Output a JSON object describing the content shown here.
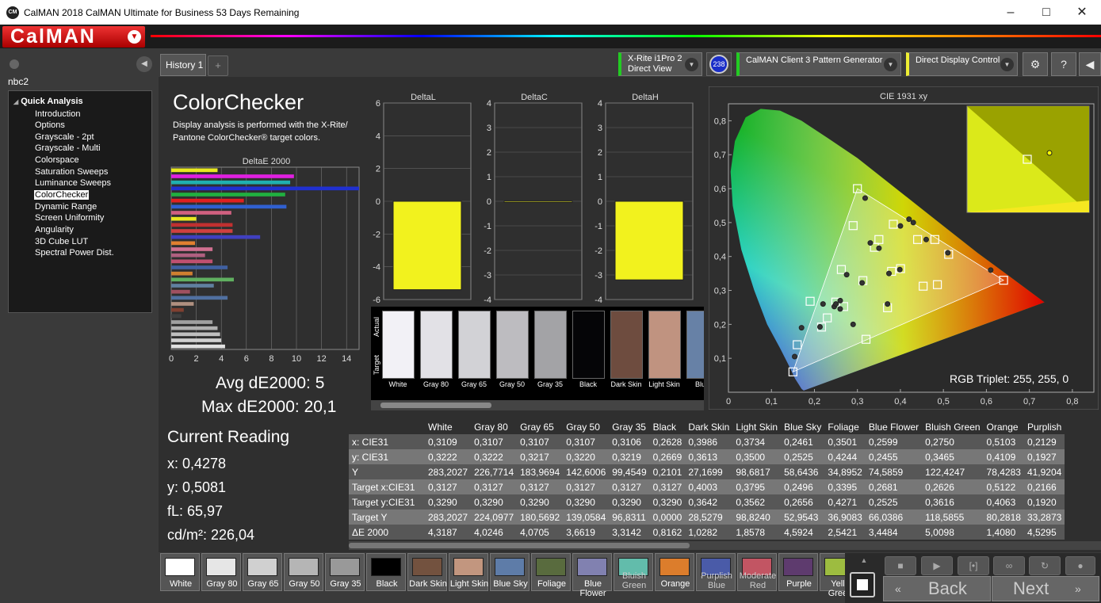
{
  "window": {
    "title": "CalMAN 2018 CalMAN Ultimate for Business 53 Days Remaining",
    "logo_text": "CalMAN"
  },
  "sidebar": {
    "session": "nbc2",
    "root": "Quick Analysis",
    "items": [
      "Introduction",
      "Options",
      "Grayscale - 2pt",
      "Grayscale - Multi",
      "Colorspace",
      "Saturation Sweeps",
      "Luminance Sweeps",
      "ColorChecker",
      "Dynamic Range",
      "Screen Uniformity",
      "Angularity",
      "3D Cube LUT",
      "Spectral Power Dist."
    ],
    "selected": "ColorChecker"
  },
  "tabs": {
    "history": "History 1",
    "add": "+"
  },
  "devices": {
    "meter_line1": "X-Rite i1Pro 2",
    "meter_line2": "Direct View",
    "badge": "238",
    "generator": "CalMAN Client 3 Pattern Generator",
    "display": "Direct Display Control"
  },
  "page": {
    "title": "ColorChecker",
    "description_line1": "Display analysis is performed with the X-Rite/",
    "description_line2": "Pantone ColorChecker® target colors.",
    "avg_label": "Avg dE2000: 5",
    "max_label": "Max dE2000: 20,1"
  },
  "current_reading": {
    "title": "Current Reading",
    "x": "x: 0,4278",
    "y": "y: 0,5081",
    "fl": "fL: 65,97",
    "cd": "cd/m²: 226,04"
  },
  "chart_data": [
    {
      "type": "bar",
      "title": "DeltaE 2000",
      "orientation": "horizontal",
      "xlim": [
        0,
        15
      ],
      "xticks": [
        0,
        2,
        4,
        6,
        8,
        10,
        12,
        14
      ],
      "series": [
        {
          "values": [
            3.7,
            9.8,
            9.5,
            20.1,
            9.1,
            5.8,
            9.2,
            4.8,
            2.0,
            4.9,
            4.9,
            7.1,
            1.9,
            3.3,
            2.7,
            3.3,
            4.5,
            1.7,
            5.0,
            3.4,
            1.5,
            4.5,
            1.8,
            1.0,
            0.8,
            3.3,
            3.7,
            3.9,
            4.0,
            4.3
          ]
        }
      ],
      "colors": [
        "#e8e820",
        "#e020e0",
        "#20b0b0",
        "#2030d0",
        "#20b040",
        "#e02020",
        "#3060d0",
        "#d06080",
        "#e8e820",
        "#c03030",
        "#d04040",
        "#4040c0",
        "#e08030",
        "#d07090",
        "#b06080",
        "#c05070",
        "#4060a0",
        "#d08030",
        "#60b060",
        "#6080a0",
        "#a05060",
        "#5070a0",
        "#b09080",
        "#804030",
        "#404040",
        "#a0a0a0",
        "#b0b0b0",
        "#c0c0c0",
        "#d0d0d0",
        "#e0e0e0"
      ]
    },
    {
      "type": "bar",
      "title": "DeltaL",
      "ylim": [
        -6,
        6
      ],
      "yticks": [
        6,
        4,
        2,
        0,
        -2,
        -4,
        -6
      ],
      "values": [
        -5.4
      ]
    },
    {
      "type": "bar",
      "title": "DeltaC",
      "ylim": [
        -4,
        4
      ],
      "yticks": [
        4,
        3,
        2,
        1,
        0,
        -1,
        -2,
        -3,
        -4
      ],
      "values": [
        0.0
      ]
    },
    {
      "type": "bar",
      "title": "DeltaH",
      "ylim": [
        -4,
        4
      ],
      "yticks": [
        4,
        3,
        2,
        1,
        0,
        -1,
        -2,
        -3,
        -4
      ],
      "values": [
        -3.2
      ]
    },
    {
      "type": "scatter",
      "title": "CIE 1931 xy",
      "xlim": [
        0,
        0.85
      ],
      "ylim": [
        0,
        0.85
      ],
      "xticks": [
        "0",
        "0,1",
        "0,2",
        "0,3",
        "0,4",
        "0,5",
        "0,6",
        "0,7",
        "0,8"
      ],
      "yticks": [
        "0,1",
        "0,2",
        "0,3",
        "0,4",
        "0,5",
        "0,6",
        "0,7",
        "0,8"
      ],
      "targets": [
        [
          0.64,
          0.33
        ],
        [
          0.3,
          0.6
        ],
        [
          0.15,
          0.06
        ],
        [
          0.3127,
          0.329
        ],
        [
          0.4003,
          0.3642
        ],
        [
          0.3795,
          0.3562
        ],
        [
          0.2496,
          0.2656
        ],
        [
          0.3395,
          0.4271
        ],
        [
          0.2681,
          0.2525
        ],
        [
          0.2626,
          0.3616
        ],
        [
          0.5122,
          0.4063
        ],
        [
          0.2166,
          0.192
        ],
        [
          0.4529,
          0.3125
        ],
        [
          0.2299,
          0.2191
        ],
        [
          0.3835,
          0.495
        ],
        [
          0.486,
          0.317
        ],
        [
          0.29,
          0.491
        ],
        [
          0.19,
          0.268
        ],
        [
          0.44,
          0.45
        ],
        [
          0.48,
          0.45
        ],
        [
          0.32,
          0.156
        ],
        [
          0.37,
          0.249
        ],
        [
          0.16,
          0.14
        ],
        [
          0.35,
          0.45
        ]
      ],
      "measured": [
        [
          0.742,
          0.574
        ],
        [
          0.318,
          0.572
        ],
        [
          0.154,
          0.105
        ],
        [
          0.3109,
          0.3222
        ],
        [
          0.3986,
          0.3613
        ],
        [
          0.3734,
          0.35
        ],
        [
          0.2461,
          0.2525
        ],
        [
          0.3501,
          0.4244
        ],
        [
          0.2599,
          0.2455
        ],
        [
          0.275,
          0.3465
        ],
        [
          0.5103,
          0.4109
        ],
        [
          0.2129,
          0.1927
        ],
        [
          0.61,
          0.36
        ],
        [
          0.22,
          0.26
        ],
        [
          0.42,
          0.51
        ],
        [
          0.46,
          0.45
        ],
        [
          0.33,
          0.44
        ],
        [
          0.25,
          0.26
        ],
        [
          0.43,
          0.5
        ],
        [
          0.4,
          0.49
        ],
        [
          0.29,
          0.2
        ],
        [
          0.37,
          0.26
        ],
        [
          0.17,
          0.19
        ],
        [
          0.26,
          0.27
        ]
      ],
      "annotation": "RGB Triplet: 255, 255, 0"
    }
  ],
  "swatches": [
    {
      "label": "White",
      "color": "#f2f1f6"
    },
    {
      "label": "Gray 80",
      "color": "#e2e1e6"
    },
    {
      "label": "Gray 65",
      "color": "#d2d2d6"
    },
    {
      "label": "Gray 50",
      "color": "#bdbcc0"
    },
    {
      "label": "Gray 35",
      "color": "#a3a3a6"
    },
    {
      "label": "Black",
      "color": "#050507"
    },
    {
      "label": "Dark Skin",
      "color": "#6e4c3f"
    },
    {
      "label": "Light Skin",
      "color": "#c09380"
    },
    {
      "label": "Blue",
      "color": "#6781a6"
    }
  ],
  "table": {
    "headers": [
      "",
      "White",
      "Gray 80",
      "Gray 65",
      "Gray 50",
      "Gray 35",
      "Black",
      "Dark Skin",
      "Light Skin",
      "Blue Sky",
      "Foliage",
      "Blue Flower",
      "Bluish Green",
      "Orange",
      "Purplish"
    ],
    "rows": [
      [
        "x: CIE31",
        "0,3109",
        "0,3107",
        "0,3107",
        "0,3107",
        "0,3106",
        "0,2628",
        "0,3986",
        "0,3734",
        "0,2461",
        "0,3501",
        "0,2599",
        "0,2750",
        "0,5103",
        "0,2129"
      ],
      [
        "y: CIE31",
        "0,3222",
        "0,3222",
        "0,3217",
        "0,3220",
        "0,3219",
        "0,2669",
        "0,3613",
        "0,3500",
        "0,2525",
        "0,4244",
        "0,2455",
        "0,3465",
        "0,4109",
        "0,1927"
      ],
      [
        "Y",
        "283,2027",
        "226,7714",
        "183,9694",
        "142,6006",
        "99,4549",
        "0,2101",
        "27,1699",
        "98,6817",
        "58,6436",
        "34,8952",
        "74,5859",
        "122,4247",
        "78,4283",
        "41,9204"
      ],
      [
        "Target x:CIE31",
        "0,3127",
        "0,3127",
        "0,3127",
        "0,3127",
        "0,3127",
        "0,3127",
        "0,4003",
        "0,3795",
        "0,2496",
        "0,3395",
        "0,2681",
        "0,2626",
        "0,5122",
        "0,2166"
      ],
      [
        "Target y:CIE31",
        "0,3290",
        "0,3290",
        "0,3290",
        "0,3290",
        "0,3290",
        "0,3290",
        "0,3642",
        "0,3562",
        "0,2656",
        "0,4271",
        "0,2525",
        "0,3616",
        "0,4063",
        "0,1920"
      ],
      [
        "Target Y",
        "283,2027",
        "224,0977",
        "180,5692",
        "139,0584",
        "96,8311",
        "0,0000",
        "28,5279",
        "98,8240",
        "52,9543",
        "36,9083",
        "66,0386",
        "118,5855",
        "80,2818",
        "33,2873"
      ],
      [
        "ΔE 2000",
        "4,3187",
        "4,0246",
        "4,0705",
        "3,6619",
        "3,3142",
        "0,8162",
        "1,0282",
        "1,8578",
        "4,5924",
        "2,5421",
        "3,4484",
        "5,0098",
        "1,4080",
        "4,5295"
      ]
    ]
  },
  "bottom_swatches": [
    {
      "label": "White",
      "color": "#ffffff"
    },
    {
      "label": "Gray 80",
      "color": "#e6e6e6"
    },
    {
      "label": "Gray 65",
      "color": "#d0d0d0"
    },
    {
      "label": "Gray 50",
      "color": "#b5b5b5"
    },
    {
      "label": "Gray 35",
      "color": "#999999"
    },
    {
      "label": "Black",
      "color": "#000000"
    },
    {
      "label": "Dark Skin",
      "color": "#73523f"
    },
    {
      "label": "Light Skin",
      "color": "#c2967f"
    },
    {
      "label": "Blue Sky",
      "color": "#5e7ca8"
    },
    {
      "label": "Foliage",
      "color": "#596b3e"
    },
    {
      "label": "Blue Flower",
      "color": "#8181b0"
    },
    {
      "label": "Bluish Green",
      "color": "#62bcab"
    },
    {
      "label": "Orange",
      "color": "#dc7d2c"
    },
    {
      "label": "Purplish Blue",
      "color": "#4a5ba8"
    },
    {
      "label": "Moderate Red",
      "color": "#c25563"
    },
    {
      "label": "Purple",
      "color": "#5e3b6e"
    },
    {
      "label": "Yello Green",
      "color": "#9dbc40"
    }
  ],
  "nav": {
    "back": "Back",
    "next": "Next"
  }
}
